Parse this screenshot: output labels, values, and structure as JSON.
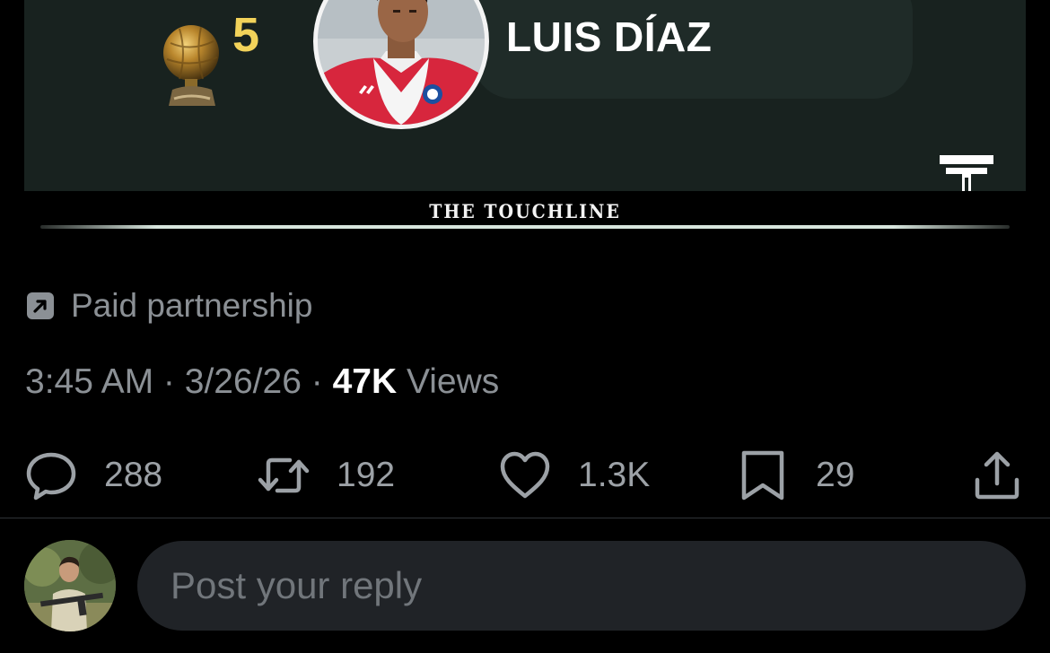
{
  "media_card": {
    "rank": "5",
    "player_name": "LUIS DÍAZ",
    "brand": "THE TOUCHLINE",
    "colors": {
      "card_bg": "#18221f",
      "rank_gold": "#f2d35a",
      "jersey_red": "#d7263d"
    },
    "icons": [
      "ballon-dor-trophy",
      "touchline-t-logo"
    ]
  },
  "post_meta": {
    "paid_partnership_label": "Paid partnership",
    "time": "3:45 AM",
    "separator": " · ",
    "date": "3/26/26",
    "views_count": "47K",
    "views_label": " Views"
  },
  "actions": {
    "replies": "288",
    "reposts": "192",
    "likes": "1.3K",
    "bookmarks": "29"
  },
  "composer": {
    "placeholder": "Post your reply"
  }
}
